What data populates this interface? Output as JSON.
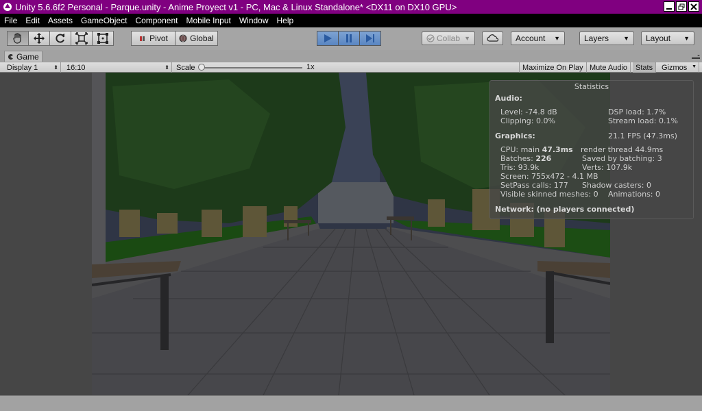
{
  "window": {
    "title": "Unity 5.6.6f2 Personal - Parque.unity - Anime Proyect v1 - PC, Mac & Linux Standalone* <DX11 on DX10 GPU>"
  },
  "menu": {
    "items": [
      "File",
      "Edit",
      "Assets",
      "GameObject",
      "Component",
      "Mobile Input",
      "Window",
      "Help"
    ]
  },
  "toolbar": {
    "pivot_label": "Pivot",
    "global_label": "Global",
    "collab_label": "Collab",
    "account_label": "Account",
    "layers_label": "Layers",
    "layout_label": "Layout"
  },
  "game": {
    "tab_label": "Game",
    "display": "Display 1",
    "aspect": "16:10",
    "scale_label": "Scale",
    "scale_value": "1x",
    "scale_level": 0.0,
    "maximize_label": "Maximize On Play",
    "mute_label": "Mute Audio",
    "stats_label": "Stats",
    "gizmos_label": "Gizmos"
  },
  "stats": {
    "title": "Statistics",
    "audio_heading": "Audio:",
    "level": "Level: -74.8 dB",
    "dsp": "DSP load: 1.7%",
    "clipping": "Clipping: 0.0%",
    "stream": "Stream load: 0.1%",
    "graphics_heading": "Graphics:",
    "fps": "21.1 FPS (47.3ms)",
    "cpu_prefix": "CPU: main",
    "cpu_value": "47.3ms",
    "render_thread": "render thread 44.9ms",
    "batches_prefix": "Batches:",
    "batches_value": "226",
    "saved_batching": "Saved by batching: 3",
    "tris": "Tris: 93.9k",
    "verts": "Verts: 107.9k",
    "screen": "Screen: 755x472 - 4.1 MB",
    "setpass": "SetPass calls: 177",
    "shadow": "Shadow casters: 0",
    "skinned": "Visible skinned meshes: 0",
    "animations": "Animations: 0",
    "network": "Network: (no players connected)"
  },
  "colors": {
    "titlebar": "#800080",
    "play_active": "#5a86c2",
    "viewport_bg": "#464646"
  }
}
